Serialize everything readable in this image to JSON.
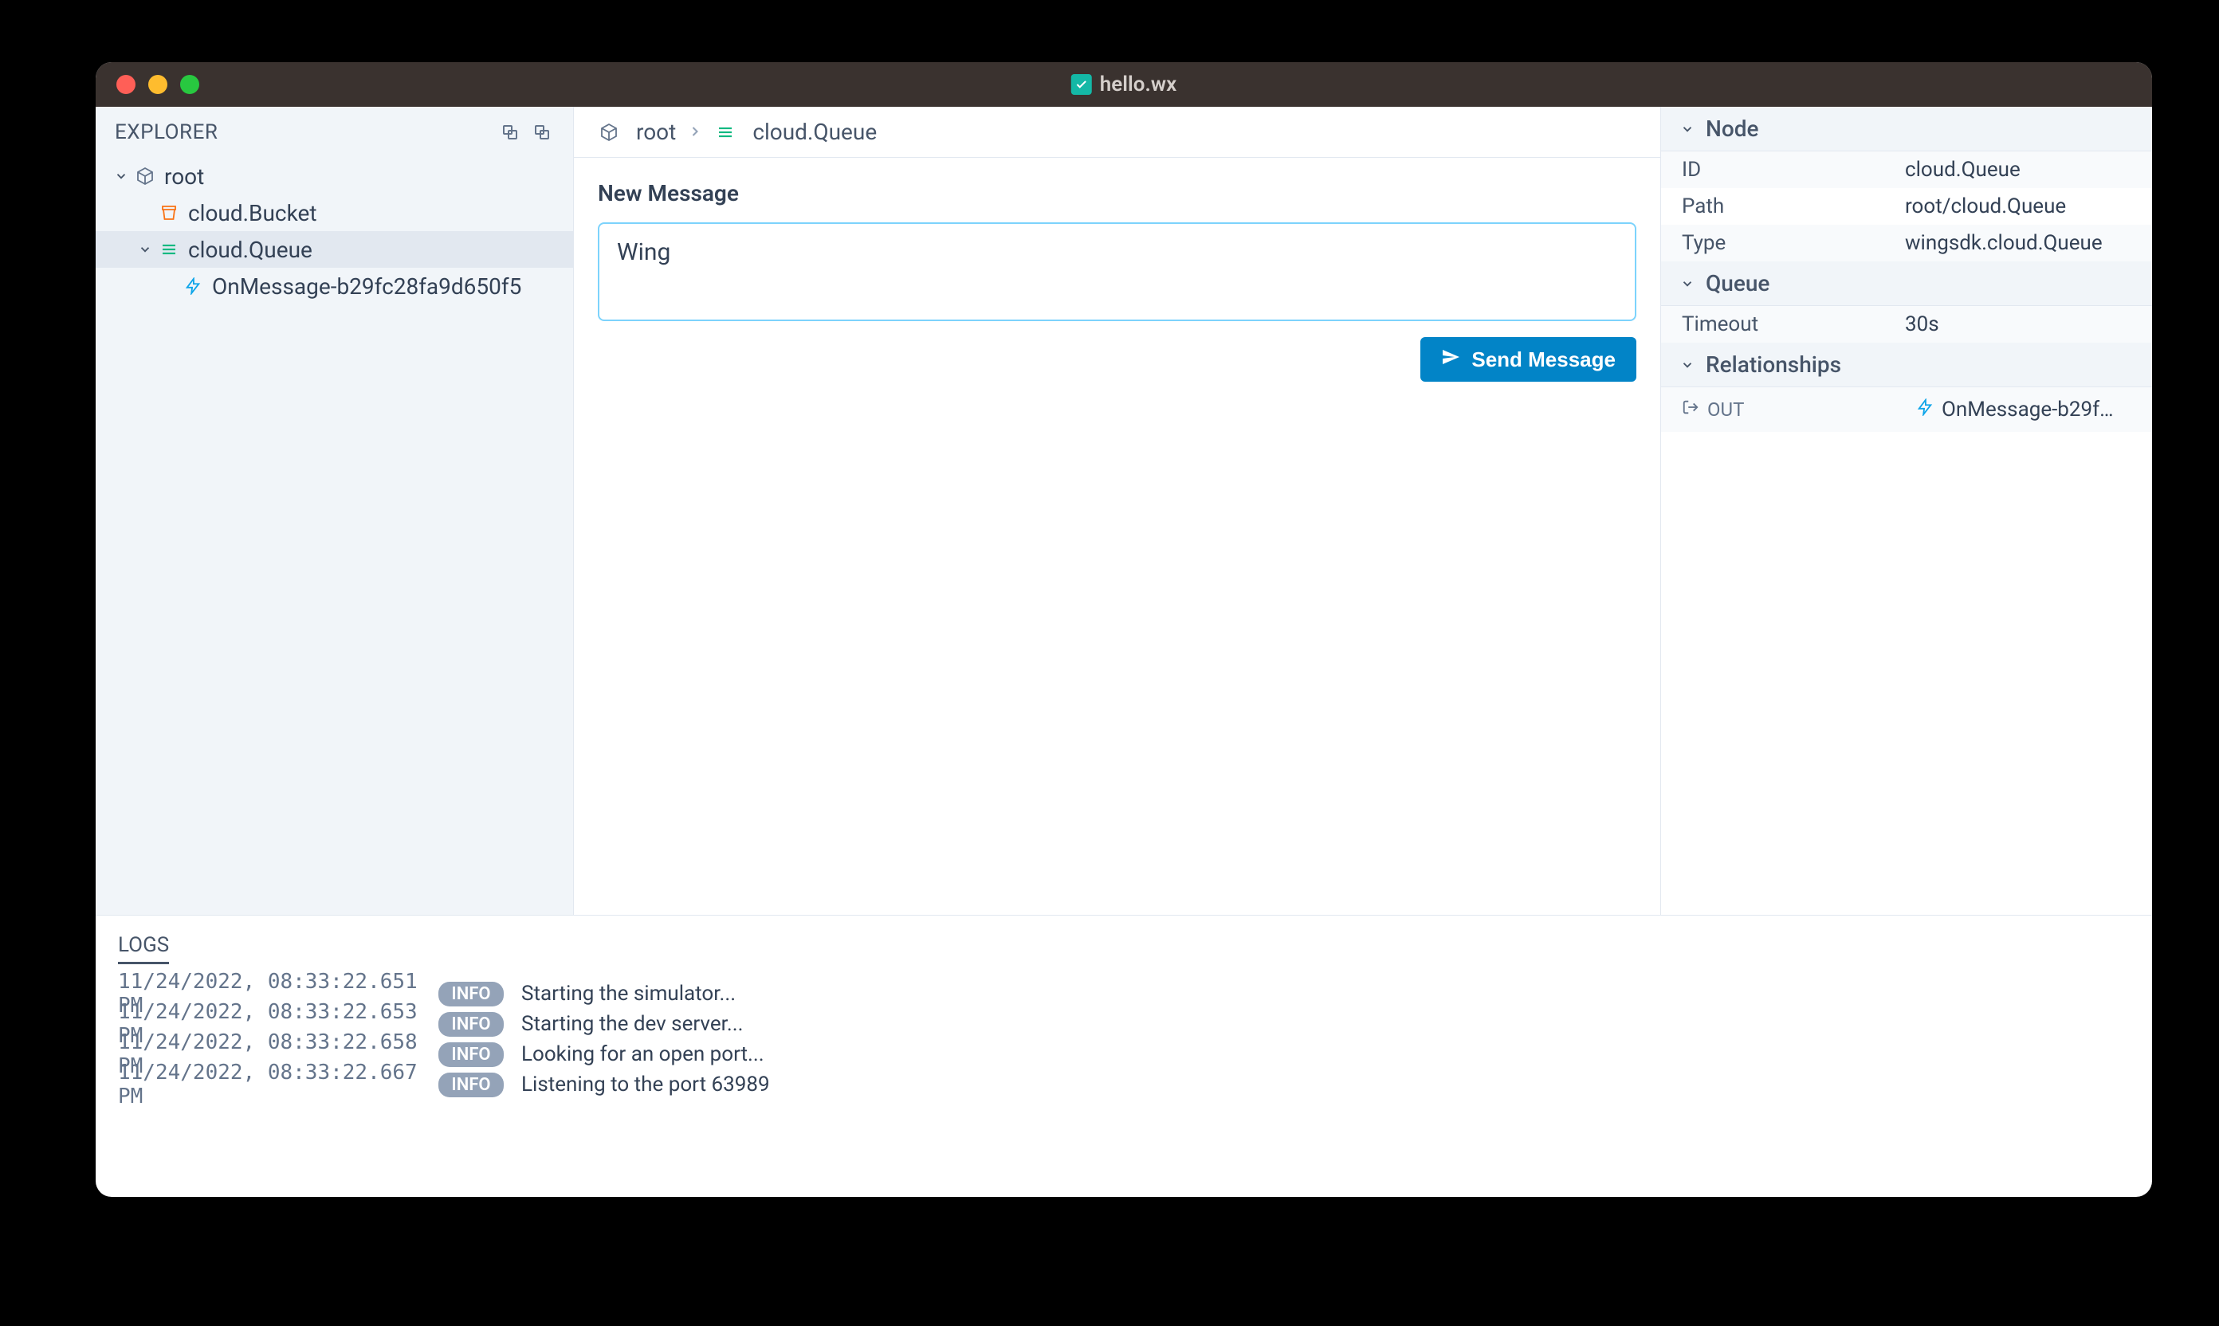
{
  "window": {
    "title": "hello.wx"
  },
  "sidebar": {
    "title": "EXPLORER",
    "tree": {
      "root": "root",
      "bucket": "cloud.Bucket",
      "queue": "cloud.Queue",
      "onmessage": "OnMessage-b29fc28fa9d650f5"
    }
  },
  "breadcrumbs": {
    "root": "root",
    "current": "cloud.Queue"
  },
  "center": {
    "section_title": "New Message",
    "message_value": "Wing",
    "send_label": "Send Message"
  },
  "inspector": {
    "node": {
      "title": "Node",
      "id_key": "ID",
      "id_val": "cloud.Queue",
      "path_key": "Path",
      "path_val": "root/cloud.Queue",
      "type_key": "Type",
      "type_val": "wingsdk.cloud.Queue"
    },
    "queue": {
      "title": "Queue",
      "timeout_key": "Timeout",
      "timeout_val": "30s"
    },
    "relationships": {
      "title": "Relationships",
      "out_label": "OUT",
      "out_target": "OnMessage-b29f…"
    }
  },
  "logs": {
    "tab": "LOGS",
    "entries": [
      {
        "ts": "11/24/2022, 08:33:22.651 PM",
        "level": "INFO",
        "msg": "Starting the simulator..."
      },
      {
        "ts": "11/24/2022, 08:33:22.653 PM",
        "level": "INFO",
        "msg": "Starting the dev server..."
      },
      {
        "ts": "11/24/2022, 08:33:22.658 PM",
        "level": "INFO",
        "msg": "Looking for an open port..."
      },
      {
        "ts": "11/24/2022, 08:33:22.667 PM",
        "level": "INFO",
        "msg": "Listening to the port 63989"
      }
    ]
  }
}
